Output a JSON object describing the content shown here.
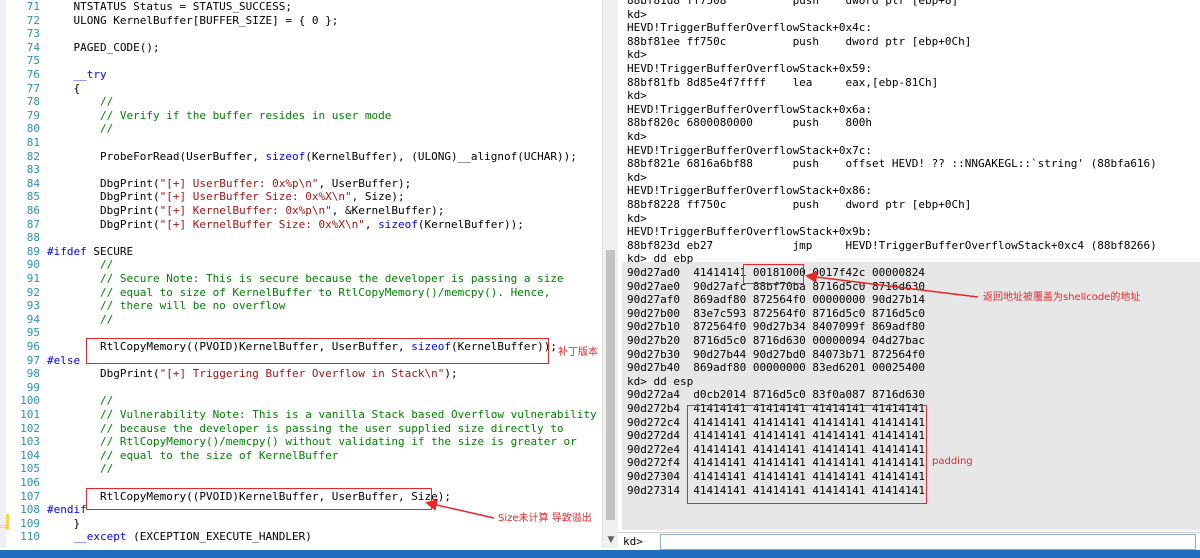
{
  "editor": {
    "lines": [
      {
        "n": "71",
        "segs": [
          {
            "t": "    NTSTATUS Status = STATUS_SUCCESS;",
            "c": ""
          }
        ]
      },
      {
        "n": "72",
        "segs": [
          {
            "t": "    ULONG KernelBuffer[BUFFER_SIZE] = { 0 };",
            "c": ""
          }
        ]
      },
      {
        "n": "73",
        "segs": []
      },
      {
        "n": "74",
        "segs": [
          {
            "t": "    PAGED_CODE();",
            "c": ""
          }
        ]
      },
      {
        "n": "75",
        "segs": []
      },
      {
        "n": "76",
        "segs": [
          {
            "t": "    ",
            "c": ""
          },
          {
            "t": "__try",
            "c": "kw"
          }
        ]
      },
      {
        "n": "77",
        "segs": [
          {
            "t": "    {",
            "c": ""
          }
        ]
      },
      {
        "n": "78",
        "segs": [
          {
            "t": "        //",
            "c": "cm"
          }
        ]
      },
      {
        "n": "79",
        "segs": [
          {
            "t": "        // Verify if the buffer resides in user mode",
            "c": "cm"
          }
        ]
      },
      {
        "n": "80",
        "segs": [
          {
            "t": "        //",
            "c": "cm"
          }
        ]
      },
      {
        "n": "81",
        "segs": []
      },
      {
        "n": "82",
        "segs": [
          {
            "t": "        ProbeForRead(UserBuffer, ",
            "c": ""
          },
          {
            "t": "sizeof",
            "c": "kw"
          },
          {
            "t": "(KernelBuffer), (ULONG)__alignof(UCHAR));",
            "c": ""
          }
        ]
      },
      {
        "n": "83",
        "segs": []
      },
      {
        "n": "84",
        "segs": [
          {
            "t": "        DbgPrint(",
            "c": ""
          },
          {
            "t": "\"[+] UserBuffer: 0x%p\\n\"",
            "c": "st"
          },
          {
            "t": ", UserBuffer);",
            "c": ""
          }
        ]
      },
      {
        "n": "85",
        "segs": [
          {
            "t": "        DbgPrint(",
            "c": ""
          },
          {
            "t": "\"[+] UserBuffer Size: 0x%X\\n\"",
            "c": "st"
          },
          {
            "t": ", Size);",
            "c": ""
          }
        ]
      },
      {
        "n": "86",
        "segs": [
          {
            "t": "        DbgPrint(",
            "c": ""
          },
          {
            "t": "\"[+] KernelBuffer: 0x%p\\n\"",
            "c": "st"
          },
          {
            "t": ", &KernelBuffer);",
            "c": ""
          }
        ]
      },
      {
        "n": "87",
        "segs": [
          {
            "t": "        DbgPrint(",
            "c": ""
          },
          {
            "t": "\"[+] KernelBuffer Size: 0x%X\\n\"",
            "c": "st"
          },
          {
            "t": ", ",
            "c": ""
          },
          {
            "t": "sizeof",
            "c": "kw"
          },
          {
            "t": "(KernelBuffer));",
            "c": ""
          }
        ]
      },
      {
        "n": "88",
        "segs": []
      },
      {
        "n": "89",
        "segs": [
          {
            "t": "#ifdef",
            "c": "kw"
          },
          {
            "t": " SECURE",
            "c": ""
          }
        ]
      },
      {
        "n": "90",
        "segs": [
          {
            "t": "        //",
            "c": "cm"
          }
        ]
      },
      {
        "n": "91",
        "segs": [
          {
            "t": "        // Secure Note: This is secure because the developer is passing a size",
            "c": "cm"
          }
        ]
      },
      {
        "n": "92",
        "segs": [
          {
            "t": "        // equal to size of KernelBuffer to RtlCopyMemory()/memcpy(). Hence,",
            "c": "cm"
          }
        ]
      },
      {
        "n": "93",
        "segs": [
          {
            "t": "        // there will be no overflow",
            "c": "cm"
          }
        ]
      },
      {
        "n": "94",
        "segs": [
          {
            "t": "        //",
            "c": "cm"
          }
        ]
      },
      {
        "n": "95",
        "segs": []
      },
      {
        "n": "96",
        "segs": [
          {
            "t": "        RtlCopyMemory((PVOID)KernelBuffer, UserBuffer, ",
            "c": ""
          },
          {
            "t": "sizeof",
            "c": "kw"
          },
          {
            "t": "(KernelBuffer));",
            "c": ""
          }
        ]
      },
      {
        "n": "97",
        "segs": [
          {
            "t": "#else",
            "c": "kw"
          }
        ]
      },
      {
        "n": "98",
        "segs": [
          {
            "t": "        DbgPrint(",
            "c": ""
          },
          {
            "t": "\"[+] Triggering Buffer Overflow in Stack\\n\"",
            "c": "st"
          },
          {
            "t": ");",
            "c": ""
          }
        ]
      },
      {
        "n": "99",
        "segs": []
      },
      {
        "n": "100",
        "segs": [
          {
            "t": "        //",
            "c": "cm"
          }
        ]
      },
      {
        "n": "101",
        "segs": [
          {
            "t": "        // Vulnerability Note: This is a vanilla Stack based Overflow vulnerability",
            "c": "cm"
          }
        ]
      },
      {
        "n": "102",
        "segs": [
          {
            "t": "        // because the developer is passing the user supplied size directly to",
            "c": "cm"
          }
        ]
      },
      {
        "n": "103",
        "segs": [
          {
            "t": "        // RtlCopyMemory()/memcpy() without validating if the size is greater or",
            "c": "cm"
          }
        ]
      },
      {
        "n": "104",
        "segs": [
          {
            "t": "        // equal to the size of KernelBuffer",
            "c": "cm"
          }
        ]
      },
      {
        "n": "105",
        "segs": [
          {
            "t": "        //",
            "c": "cm"
          }
        ]
      },
      {
        "n": "106",
        "segs": []
      },
      {
        "n": "107",
        "segs": [
          {
            "t": "        RtlCopyMemory((PVOID)KernelBuffer, UserBuffer, Size);",
            "c": ""
          }
        ]
      },
      {
        "n": "108",
        "segs": [
          {
            "t": "#endif",
            "c": "kw"
          }
        ]
      },
      {
        "n": "109",
        "segs": [
          {
            "t": "    }",
            "c": ""
          }
        ]
      },
      {
        "n": "110",
        "segs": [
          {
            "t": "    ",
            "c": ""
          },
          {
            "t": "__except",
            "c": "kw"
          },
          {
            "t": " (EXCEPTION_EXECUTE_HANDLER)",
            "c": ""
          }
        ]
      }
    ]
  },
  "output": {
    "lines": [
      "88bf81d8 ff7508          push    dword ptr [ebp+8]",
      "kd>",
      "HEVD!TriggerBufferOverflowStack+0x4c:",
      "88bf81ee ff750c          push    dword ptr [ebp+0Ch]",
      "kd>",
      "HEVD!TriggerBufferOverflowStack+0x59:",
      "88bf81fb 8d85e4f7ffff    lea     eax,[ebp-81Ch]",
      "kd>",
      "HEVD!TriggerBufferOverflowStack+0x6a:",
      "88bf820c 6800080000      push    800h",
      "kd>",
      "HEVD!TriggerBufferOverflowStack+0x7c:",
      "88bf821e 6816a6bf88      push    offset HEVD! ?? ::NNGAKEGL::`string' (88bfa616)",
      "kd>",
      "HEVD!TriggerBufferOverflowStack+0x86:",
      "88bf8228 ff750c          push    dword ptr [ebp+0Ch]",
      "kd>",
      "HEVD!TriggerBufferOverflowStack+0x9b:",
      "88bf823d eb27            jmp     HEVD!TriggerBufferOverflowStack+0xc4 (88bf8266)",
      "kd> dd ebp",
      "90d27ad0  41414141 00181000 0017f42c 00000824",
      "90d27ae0  90d27afc 88bf70ba 8716d5c0 8716d630",
      "90d27af0  869adf80 872564f0 00000000 90d27b14",
      "90d27b00  83e7c593 872564f0 8716d5c0 8716d5c0",
      "90d27b10  872564f0 90d27b34 8407099f 869adf80",
      "90d27b20  8716d5c0 8716d630 00000094 04d27bac",
      "90d27b30  90d27b44 90d27bd0 84073b71 872564f0",
      "90d27b40  869adf80 00000000 83ed6201 00025400",
      "kd> dd esp",
      "90d272a4  d0cb2014 8716d5c0 83f0a087 8716d630",
      "90d272b4  41414141 41414141 41414141 41414141",
      "90d272c4  41414141 41414141 41414141 41414141",
      "90d272d4  41414141 41414141 41414141 41414141",
      "90d272e4  41414141 41414141 41414141 41414141",
      "90d272f4  41414141 41414141 41414141 41414141",
      "90d27304  41414141 41414141 41414141 41414141",
      "90d27314  41414141 41414141 41414141 41414141"
    ]
  },
  "command": {
    "prompt": "kd>",
    "value": ""
  },
  "annotations": {
    "patch_version": "补丁版本",
    "size_unchecked": "Size未计算 导致溢出",
    "return_address": "返回地址被覆盖为shellcode的地址",
    "padding": "padding",
    "color": "#e8262a"
  },
  "icons": {
    "current_line_marker": "⇨",
    "scroll_down": "▼"
  }
}
